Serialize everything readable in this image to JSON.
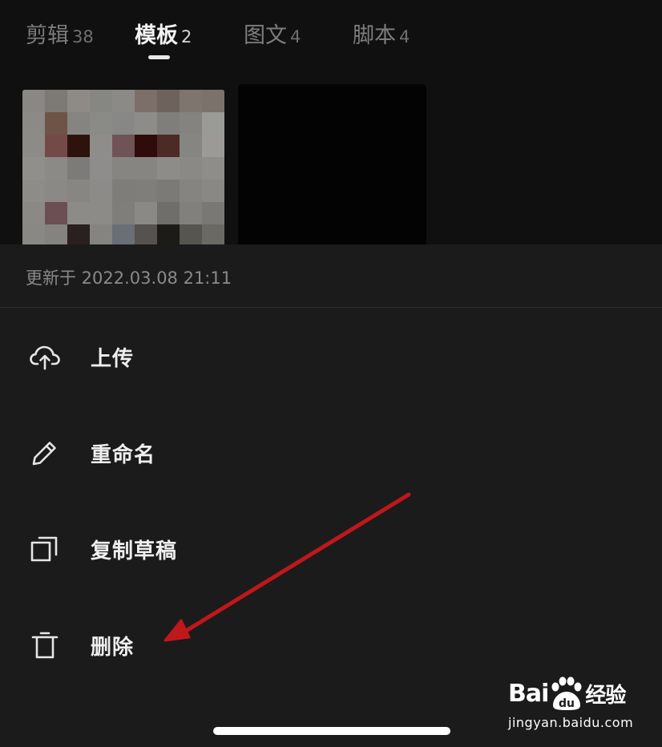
{
  "tabs": [
    {
      "label": "剪辑",
      "count": "38"
    },
    {
      "label": "模板",
      "count": "2"
    },
    {
      "label": "图文",
      "count": "4"
    },
    {
      "label": "脚本",
      "count": "4"
    }
  ],
  "sheet": {
    "updated_text": "更新于 2022.03.08 21:11",
    "menu": [
      {
        "label": "上传",
        "icon": "cloud-upload-icon"
      },
      {
        "label": "重命名",
        "icon": "pencil-icon"
      },
      {
        "label": "复制草稿",
        "icon": "copy-icon"
      },
      {
        "label": "删除",
        "icon": "trash-icon"
      }
    ]
  },
  "watermark": {
    "logo_text_1": "Bai",
    "logo_text_2": "du",
    "logo_text_3": "经验",
    "url": "jingyan.baidu.com"
  },
  "colors": {
    "background": "#000000",
    "sheet_bg": "#1b1b1b",
    "annotation_arrow": "#c0171a",
    "active_tab": "#f2f2f2",
    "inactive_tab": "#7d7d7d"
  }
}
